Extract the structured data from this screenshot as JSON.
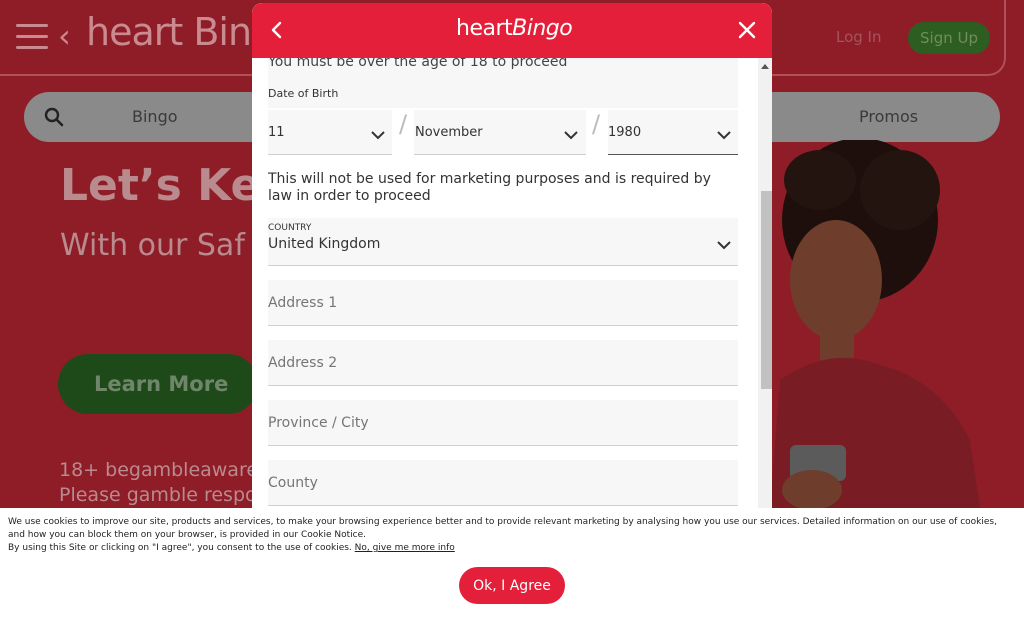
{
  "background": {
    "logo": "heart Bingo",
    "login": "Log In",
    "signup": "Sign Up",
    "nav_bingo": "Bingo",
    "nav_promos": "Promos",
    "hero_title": "Let’s Kee",
    "hero_subtitle": "With our Saf",
    "learn_more": "Learn More",
    "legal_line1": "18+ begambleaware",
    "legal_line2": "Please gamble respo"
  },
  "modal": {
    "logo_heart": "heart",
    "logo_bingo": "Bingo",
    "age_notice": "You must be over the age of 18 to proceed",
    "dob_label": "Date of Birth",
    "dob_day": "11",
    "dob_month": "November",
    "dob_year": "1980",
    "dob_separator": "/",
    "marketing_note": "This will not be used for marketing purposes and is required by law in order to proceed",
    "country_label": "COUNTRY",
    "country_value": "United Kingdom",
    "address1_placeholder": "Address 1",
    "address2_placeholder": "Address 2",
    "city_placeholder": "Province / City",
    "county_placeholder": "County"
  },
  "cookie": {
    "text_line1": "We use cookies to improve our site, products and services, to make your browsing experience better and to provide relevant marketing by analysing how you use our services. Detailed information on our use of cookies, and how you can block them on your browser, is provided in our Cookie Notice.",
    "text_line2": "By using this Site or clicking on \"I agree\", you consent to the use of cookies.",
    "more_info_link": "No, give me more info",
    "agree_button": "Ok, I Agree"
  },
  "colors": {
    "brand_red": "#e41f3a",
    "background_dim": "#8f1d28"
  }
}
